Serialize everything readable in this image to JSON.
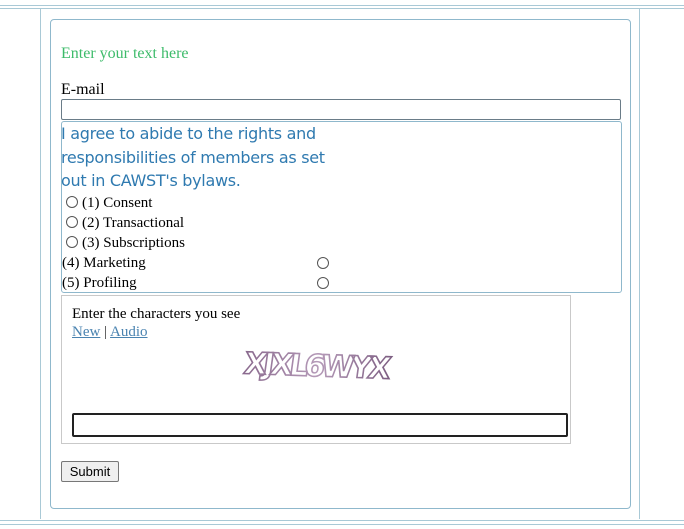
{
  "form": {
    "intro_text": "Enter your text here",
    "email_label": "E-mail",
    "email_value": "",
    "agreement_text": "I agree to abide to the rights and responsibilities of members as set out in CAWST's bylaws.",
    "options": [
      {
        "label": "(1) Consent"
      },
      {
        "label": "(2) Transactional"
      },
      {
        "label": "(3) Subscriptions"
      },
      {
        "label": "(4) Marketing"
      },
      {
        "label": "(5) Profiling"
      }
    ],
    "captcha": {
      "title": "Enter the characters you see",
      "new_link": "New",
      "separator": "|",
      "audio_link": "Audio",
      "image_text": "XJXL6WYX",
      "input_value": ""
    },
    "submit_label": "Submit"
  },
  "colors": {
    "intro_green": "#3dbb6a",
    "agreement_blue": "#2f7ab0",
    "frame_border": "#8fb8cc",
    "link_blue": "#4a83b0"
  }
}
